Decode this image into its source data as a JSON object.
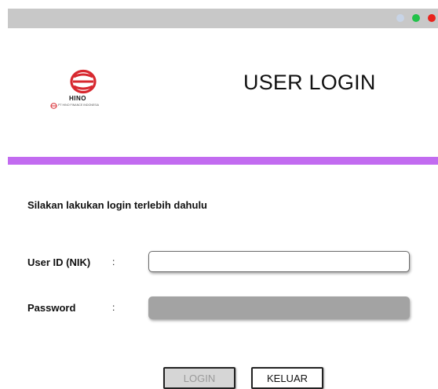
{
  "window": {
    "controls": [
      {
        "name": "minimize",
        "color": "#c8d4e6"
      },
      {
        "name": "maximize",
        "color": "#22c24a"
      },
      {
        "name": "close",
        "color": "#e8231c"
      }
    ]
  },
  "logo": {
    "brand": "HINO",
    "company": "PT HINO FINANCE INDONESIA",
    "icon": "hino-logo-icon",
    "brand_color": "#d7282f"
  },
  "header": {
    "title": "USER LOGIN"
  },
  "accent_color": "#c26bf0",
  "form": {
    "instruction": "Silakan lakukan login terlebih dahulu",
    "userid": {
      "label": "User ID (NIK)",
      "separator": ":",
      "value": "",
      "placeholder": ""
    },
    "password": {
      "label": "Password",
      "separator": ":",
      "value": "",
      "placeholder": ""
    }
  },
  "buttons": {
    "login": "LOGIN",
    "keluar": "KELUAR"
  }
}
